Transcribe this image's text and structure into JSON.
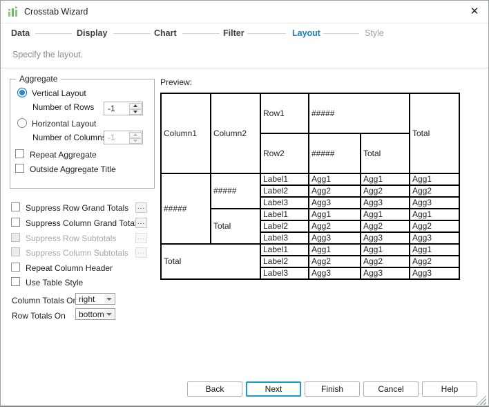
{
  "window": {
    "title": "Crosstab Wizard",
    "close_glyph": "✕"
  },
  "steps": [
    {
      "label": "Data",
      "state": "done"
    },
    {
      "label": "Display",
      "state": "done"
    },
    {
      "label": "Chart",
      "state": "done"
    },
    {
      "label": "Filter",
      "state": "done"
    },
    {
      "label": "Layout",
      "state": "active"
    },
    {
      "label": "Style",
      "state": "upcoming"
    }
  ],
  "subtitle": "Specify the layout.",
  "aggregate": {
    "legend": "Aggregate",
    "vertical_label": "Vertical Layout",
    "rows_label": "Number of Rows",
    "rows_value": "-1",
    "horizontal_label": "Horizontal Layout",
    "columns_label": "Number of Columns",
    "columns_value": "-1",
    "repeat_label": "Repeat Aggregate",
    "outside_label": "Outside Aggregate Title"
  },
  "options": {
    "suppress_row_grand": "Suppress Row Grand Totals",
    "suppress_col_grand": "Suppress Column Grand Totals",
    "suppress_row_sub": "Suppress Row Subtotals",
    "suppress_col_sub": "Suppress Column Subtotals",
    "repeat_col_header": "Repeat Column Header",
    "use_table_style": "Use Table Style",
    "ellipsis": "..."
  },
  "totals": {
    "column_label": "Column Totals On",
    "column_value": "right",
    "row_label": "Row Totals On",
    "row_value": "bottom"
  },
  "preview": {
    "label": "Preview:",
    "header": {
      "col1": "Column1",
      "col2": "Column2",
      "row1": "Row1",
      "row1_agg": "#####",
      "row2": "Row2",
      "row2_agg": "#####",
      "row2_total": "Total",
      "grand_total": "Total"
    },
    "body": {
      "row_group": "#####",
      "sub_group": "#####",
      "sub_total": "Total",
      "grand_total": "Total",
      "rows": [
        {
          "label": "Label1",
          "a1": "Agg1",
          "a2": "Agg1",
          "a3": "Agg1"
        },
        {
          "label": "Label2",
          "a1": "Agg2",
          "a2": "Agg2",
          "a3": "Agg2"
        },
        {
          "label": "Label3",
          "a1": "Agg3",
          "a2": "Agg3",
          "a3": "Agg3"
        },
        {
          "label": "Label1",
          "a1": "Agg1",
          "a2": "Agg1",
          "a3": "Agg1"
        },
        {
          "label": "Label2",
          "a1": "Agg2",
          "a2": "Agg2",
          "a3": "Agg2"
        },
        {
          "label": "Label3",
          "a1": "Agg3",
          "a2": "Agg3",
          "a3": "Agg3"
        },
        {
          "label": "Label1",
          "a1": "Agg1",
          "a2": "Agg1",
          "a3": "Agg1"
        },
        {
          "label": "Label2",
          "a1": "Agg2",
          "a2": "Agg2",
          "a3": "Agg2"
        },
        {
          "label": "Label3",
          "a1": "Agg3",
          "a2": "Agg3",
          "a3": "Agg3"
        }
      ]
    }
  },
  "buttons": {
    "back": "Back",
    "next": "Next",
    "finish": "Finish",
    "cancel": "Cancel",
    "help": "Help"
  },
  "colors": {
    "accent_blue": "#1780d0",
    "next_border_blue": "#189ad6",
    "icon_green": "#7cc36f",
    "step_done": "#3f3f3f",
    "step_upcoming": "#a3a3a3"
  }
}
